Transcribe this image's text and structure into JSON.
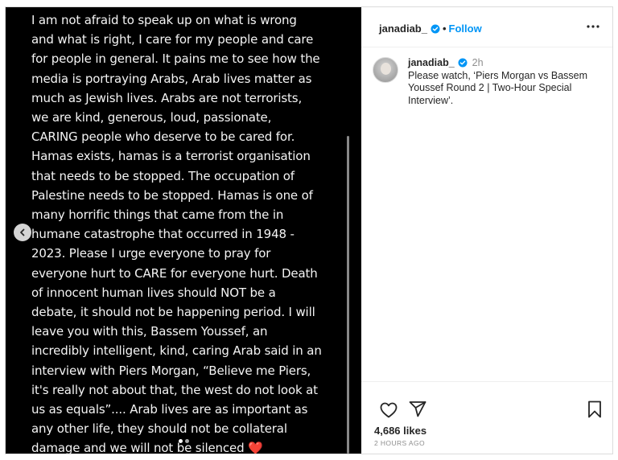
{
  "post": {
    "media_text": "I am not afraid to speak up on what is wrong\nand what is right, I care for my people and care\nfor people in general. It pains me to see how the\nmedia is portraying Arabs, Arab lives matter as\nmuch as Jewish lives. Arabs are not terrorists,\nwe are kind, generous, loud, passionate,\nCARING people who deserve to be cared for.\nHamas exists, hamas is a terrorist organisation\nthat needs to be stopped. The occupation of\nPalestine needs to be stopped. Hamas is one of\nmany horrific things that came from the in\nhumane catastrophe that occurred in 1948 -\n2023. Please I urge everyone to pray for\neveryone hurt to CARE for everyone hurt. Death\nof innocent human lives should NOT be a\ndebate, it should not be happening period. I will\nleave you with this, Bassem Youssef, an\nincredibly intelligent, kind, caring Arab said in an\ninterview with Piers Morgan, “Believe me Piers,\nit's really not about that, the west do not look at\nus as equals”.... Arab lives are as important as\nany other life, they should not be collateral\ndamage and we will not be silenced ",
    "media_emoji": "❤️",
    "carousel_dots": 2,
    "carousel_active": 1
  },
  "header": {
    "username": "janadiab_",
    "separator": "•",
    "follow_label": "Follow",
    "more_icon": "more-horizontal-icon"
  },
  "caption": {
    "username": "janadiab_",
    "time": "2h",
    "text": "Please watch, ‘Piers Morgan vs Bassem Youssef Round 2 | Two-Hour Special Interview’."
  },
  "footer": {
    "likes": "4,686 likes",
    "time_ago": "2 HOURS AGO"
  },
  "colors": {
    "accent": "#0095f6",
    "verified": "#0095f6",
    "heart": "#e0142e",
    "media_bg": "#000000"
  }
}
